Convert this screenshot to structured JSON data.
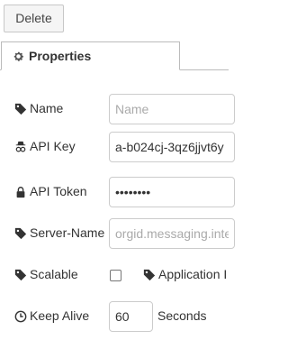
{
  "toolbar": {
    "delete_label": "Delete"
  },
  "tab": {
    "label": "Properties",
    "icon": "gear-icon"
  },
  "fields": {
    "name": {
      "label": "Name",
      "value": "",
      "placeholder": "Name",
      "icon": "tag-icon"
    },
    "api_key": {
      "label": "API Key",
      "value": "a-b024cj-3qz6jjvt6y",
      "icon": "spy-icon"
    },
    "api_token": {
      "label": "API Token",
      "value": "••••••••",
      "icon": "lock-icon"
    },
    "server_name": {
      "label": "Server-Name",
      "value": "",
      "placeholder": "orgid.messaging.inte",
      "icon": "tag-icon"
    },
    "scalable": {
      "label": "Scalable",
      "checked": false,
      "icon": "tag-icon"
    },
    "application_id": {
      "label": "Application I",
      "icon": "tag-icon"
    },
    "keep_alive": {
      "label": "Keep Alive",
      "value": "60",
      "unit": "Seconds",
      "icon": "clock-icon"
    }
  }
}
